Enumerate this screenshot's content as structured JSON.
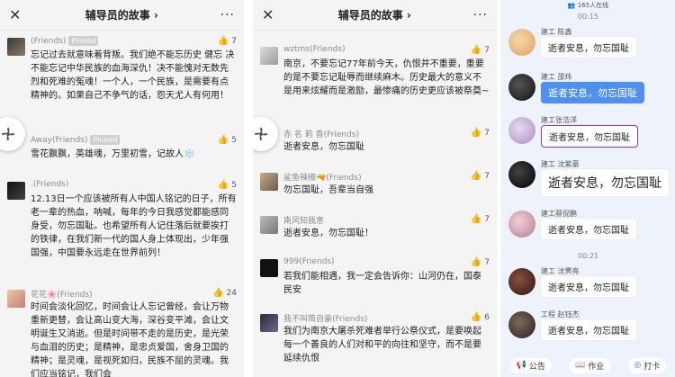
{
  "panel1": {
    "title": "辅导员的故事 ›",
    "close": "✕",
    "more": "···",
    "comments": [
      {
        "name": "(Friends)",
        "pinned": "Pinned",
        "likes": "7",
        "text": "忘记过去就意味着背叛。我们绝不能忘历史 健忘 决不能忘记中华民族的血海深仇！决不能愧对无数先烈和死难的冤魂！一个人，一个民族，是需要有点精神的。如果自己不争气的话，怨天尤人有何用！"
      },
      {
        "name": "Away(Friends)",
        "pinned": "Pinned",
        "likes": "5",
        "text": "雪花飘飘，英雄魂，万里初雪，记故人❄️"
      },
      {
        "name": ".(Friends)",
        "pinned": "",
        "likes": "5",
        "text": "12.13日一个应该被所有人中国人铭记的日子，所有老一辈的热血，呐喊，每年的今日我感觉都能感同身受，勿忘国耻。也希望所有人记住落后就要挨打的铁律，在我们新一代的国人身上体现出，少年强国强，中国要永远走在世界前列！"
      },
      {
        "name": "花花🌸(Friends)",
        "pinned": "",
        "likes": "24",
        "text": "时间会淡化回忆，时间会让人忘记曾经，会让万物重新更替，会让高山变大海，深谷变平滩，会让文明诞生又消逝。但是时间带不走的是历史，是光荣与血泪的历史；是精神，是忠贞爱国，舍身卫国的精神；是灵魂，是视死如归，民族不屈的灵魂。我们应当铭记，我们会"
      }
    ]
  },
  "panel2": {
    "title": "辅导员的故事 ›",
    "close": "✕",
    "more": "···",
    "comments": [
      {
        "name": "wztms(Friends)",
        "likes": "7",
        "text": "南京，不要忘记77年前今天，仇恨并不重要，重要的是不要忘记耻辱而继续麻木。历史最大的意义不是用来炫耀而是激励，最惨痛的历史更应该被祭奠~"
      },
      {
        "name": "赤 名 莉 香(Friends)",
        "likes": "7",
        "text": "逝者安息，勿忘国耻"
      },
      {
        "name": "鲨鱼辣椒🔫(Friends)",
        "likes": "7",
        "text": "勿忘国耻，吾辈当自强"
      },
      {
        "name": "南风知我意",
        "likes": "7",
        "text": "逝者安息，勿忘国耻！"
      },
      {
        "name": "999(Friends)",
        "likes": "7",
        "text": "若我们能相遇，我一定会告诉你：山河仍在，国泰民安"
      },
      {
        "name": "我不叫简自豪(Friends)",
        "likes": "6",
        "text": "我们为南京大屠杀死难者举行公祭仪式，是要唤起每一个善良的人们对和平的向往和坚守，而不是要延续仇恨"
      }
    ]
  },
  "panel3": {
    "status": "165人在线",
    "times": [
      "00:15",
      "00:21"
    ],
    "messages": [
      {
        "name": "建工 陈鑫",
        "text": "逝者安息，勿忘国耻",
        "style": "hand"
      },
      {
        "name": "建工 邵炜",
        "text": "逝者安息，勿忘国耻",
        "style": "blue"
      },
      {
        "name": "建工张浩洋",
        "text": "逝者安息，勿忘国耻",
        "style": "hand"
      },
      {
        "name": "建工 沈紫豪",
        "text": "逝者安息，勿忘国耻",
        "style": "big"
      },
      {
        "name": "建工蔡倪鹏",
        "text": "逝者安息，勿忘国耻",
        "style": "hand"
      },
      {
        "name": "建工 沈霁亮",
        "text": "逝者安息，勿忘国耻",
        "style": "hand"
      },
      {
        "name": "工程 赵钰杰",
        "text": "逝者安息，勿忘国耻",
        "style": "hand"
      }
    ],
    "bottom": {
      "notice": "公告",
      "homework": "作业",
      "checkin": "打卡"
    }
  }
}
